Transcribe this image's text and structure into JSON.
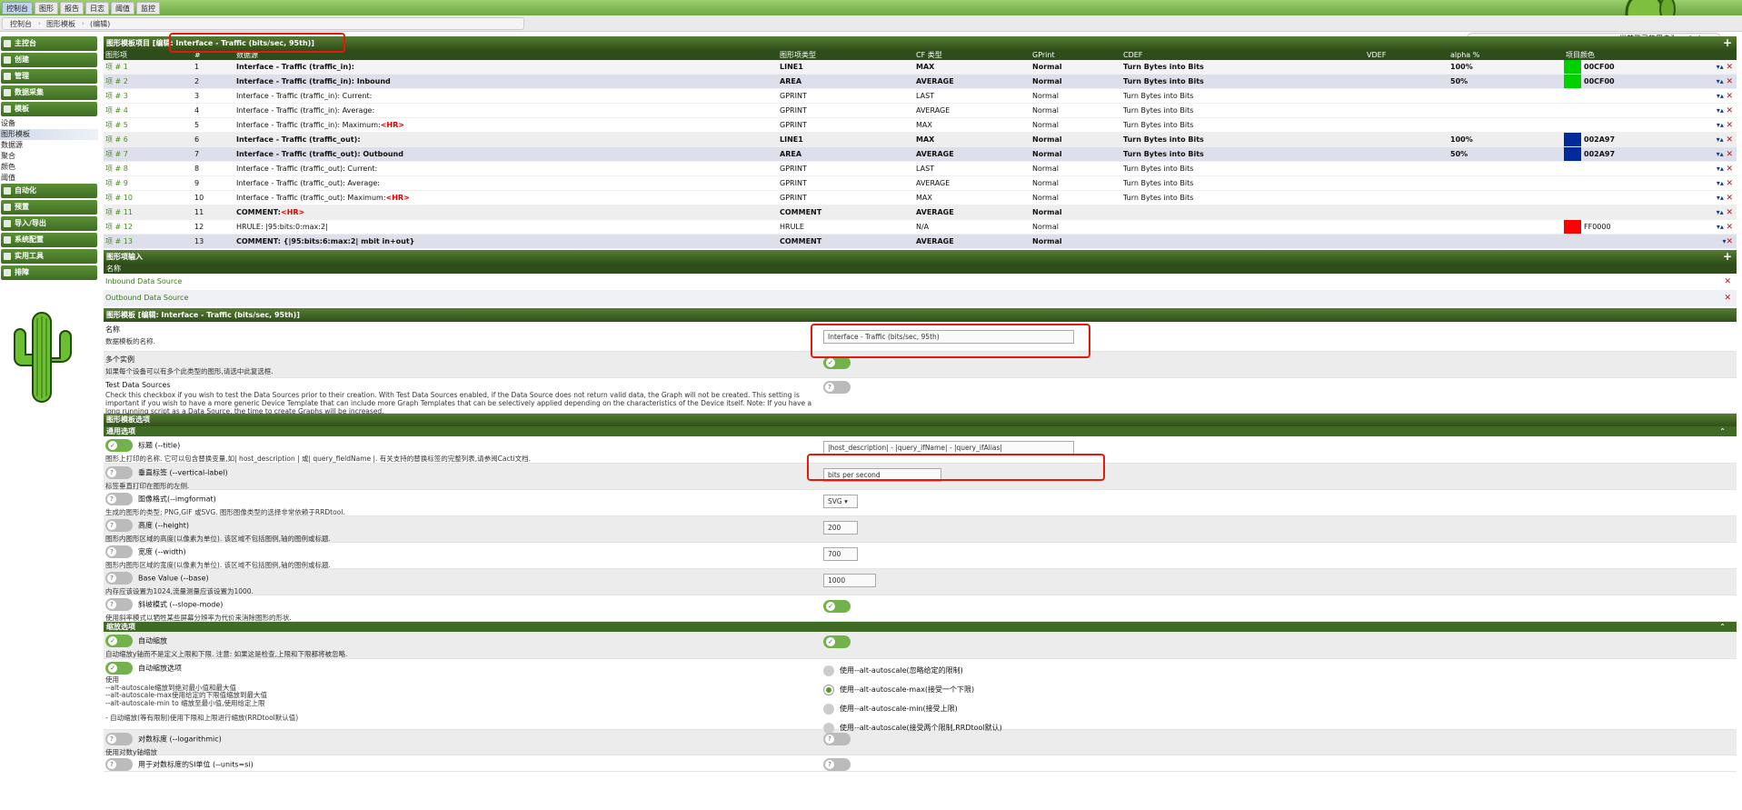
{
  "tabs": [
    "控制台",
    "图形",
    "报告",
    "日志",
    "阈值",
    "监控"
  ],
  "breadcrumbs": [
    "控制台",
    "图形模板",
    "(编辑)"
  ],
  "user_label": "当前登录的用户为: admin ▲",
  "sidebar": {
    "sections": [
      {
        "label": "主控台"
      },
      {
        "label": "创建"
      },
      {
        "label": "管理"
      },
      {
        "label": "数据采集"
      },
      {
        "label": "模板"
      }
    ],
    "template_items": [
      "设备",
      "图形模板",
      "数据源",
      "聚合",
      "颜色",
      "阈值"
    ],
    "sections2": [
      {
        "label": "自动化"
      },
      {
        "label": "预置"
      },
      {
        "label": "导入/导出"
      },
      {
        "label": "系统配置"
      },
      {
        "label": "实用工具"
      },
      {
        "label": "排障"
      }
    ]
  },
  "items_header": {
    "title": "图形模板项目 [编辑: Interface - Traffic (bits/sec, 95th)]",
    "plus": "+"
  },
  "item_columns": [
    "图形项",
    "#",
    "数据源",
    "图形项类型",
    "CF 类型",
    "GPrint",
    "CDEF",
    "VDEF",
    "alpha %",
    "项目颜色"
  ],
  "items": [
    {
      "item": "项 # 1",
      "n": "1",
      "ds": "Interface - Traffic (traffic_in):",
      "hr": "",
      "type": "LINE1",
      "cf": "MAX",
      "gp": "Normal",
      "cdef": "Turn Bytes into Bits",
      "alpha": "100%",
      "color": "00CF00",
      "hex": "#00CF00",
      "bold": true,
      "bg": "alt1",
      "up": true
    },
    {
      "item": "项 # 2",
      "n": "2",
      "ds": "Interface - Traffic (traffic_in): Inbound",
      "hr": "",
      "type": "AREA",
      "cf": "AVERAGE",
      "gp": "Normal",
      "cdef": "Turn Bytes into Bits",
      "alpha": "50%",
      "color": "00CF00",
      "hex": "#00CF00",
      "bold": true,
      "bg": "alt2",
      "up": true
    },
    {
      "item": "项 # 3",
      "n": "3",
      "ds": "Interface - Traffic (traffic_in): Current:",
      "hr": "",
      "type": "GPRINT",
      "cf": "LAST",
      "gp": "Normal",
      "cdef": "Turn Bytes into Bits",
      "alpha": "",
      "color": "",
      "hex": "",
      "bold": false,
      "bg": "",
      "up": true
    },
    {
      "item": "项 # 4",
      "n": "4",
      "ds": "Interface - Traffic (traffic_in): Average:",
      "hr": "",
      "type": "GPRINT",
      "cf": "AVERAGE",
      "gp": "Normal",
      "cdef": "Turn Bytes into Bits",
      "alpha": "",
      "color": "",
      "hex": "",
      "bold": false,
      "bg": "",
      "up": true
    },
    {
      "item": "项 # 5",
      "n": "5",
      "ds": "Interface - Traffic (traffic_in): Maximum:",
      "hr": "<HR>",
      "type": "GPRINT",
      "cf": "MAX",
      "gp": "Normal",
      "cdef": "Turn Bytes into Bits",
      "alpha": "",
      "color": "",
      "hex": "",
      "bold": false,
      "bg": "",
      "up": true
    },
    {
      "item": "项 # 6",
      "n": "6",
      "ds": "Interface - Traffic (traffic_out):",
      "hr": "",
      "type": "LINE1",
      "cf": "MAX",
      "gp": "Normal",
      "cdef": "Turn Bytes into Bits",
      "alpha": "100%",
      "color": "002A97",
      "hex": "#002A97",
      "bold": true,
      "bg": "alt3",
      "up": true
    },
    {
      "item": "项 # 7",
      "n": "7",
      "ds": "Interface - Traffic (traffic_out): Outbound",
      "hr": "",
      "type": "AREA",
      "cf": "AVERAGE",
      "gp": "Normal",
      "cdef": "Turn Bytes into Bits",
      "alpha": "50%",
      "color": "002A97",
      "hex": "#002A97",
      "bold": true,
      "bg": "alt2",
      "up": true
    },
    {
      "item": "项 # 8",
      "n": "8",
      "ds": "Interface - Traffic (traffic_out): Current:",
      "hr": "",
      "type": "GPRINT",
      "cf": "LAST",
      "gp": "Normal",
      "cdef": "Turn Bytes into Bits",
      "alpha": "",
      "color": "",
      "hex": "",
      "bold": false,
      "bg": "",
      "up": true
    },
    {
      "item": "项 # 9",
      "n": "9",
      "ds": "Interface - Traffic (traffic_out): Average:",
      "hr": "",
      "type": "GPRINT",
      "cf": "AVERAGE",
      "gp": "Normal",
      "cdef": "Turn Bytes into Bits",
      "alpha": "",
      "color": "",
      "hex": "",
      "bold": false,
      "bg": "",
      "up": true
    },
    {
      "item": "项 # 10",
      "n": "10",
      "ds": "Interface - Traffic (traffic_out): Maximum:",
      "hr": "<HR>",
      "type": "GPRINT",
      "cf": "MAX",
      "gp": "Normal",
      "cdef": "Turn Bytes into Bits",
      "alpha": "",
      "color": "",
      "hex": "",
      "bold": false,
      "bg": "",
      "up": true
    },
    {
      "item": "项 # 11",
      "n": "11",
      "ds": "COMMENT:",
      "hr": "<HR>",
      "type": "COMMENT",
      "cf": "AVERAGE",
      "gp": "Normal",
      "cdef": "",
      "alpha": "",
      "color": "",
      "hex": "",
      "bold": true,
      "bg": "alt3",
      "up": true
    },
    {
      "item": "项 # 12",
      "n": "12",
      "ds": "HRULE: |95:bits:0:max:2|",
      "hr": "",
      "type": "HRULE",
      "cf": "N/A",
      "gp": "Normal",
      "cdef": "",
      "alpha": "",
      "color": "FF0000",
      "hex": "#FF0000",
      "bold": false,
      "bg": "",
      "up": true
    },
    {
      "item": "项 # 13",
      "n": "13",
      "ds": "COMMENT: {|95:bits:6:max:2| mbit in+out}",
      "hr": "",
      "type": "COMMENT",
      "cf": "AVERAGE",
      "gp": "Normal",
      "cdef": "",
      "alpha": "",
      "color": "",
      "hex": "",
      "bold": true,
      "bg": "alt2",
      "up": false
    }
  ],
  "inputs_header": {
    "title": "图形项输入",
    "name_col": "名称"
  },
  "inputs": [
    "Inbound Data Source",
    "Outbound Data Source"
  ],
  "template_header": "图形模板 [编辑: Interface - Traffic (bits/sec, 95th)]",
  "tpl": {
    "name_label": "名称",
    "name_desc": "数据模板的名称.",
    "name_value": "Interface - Traffic (bits/sec, 95th)",
    "multi_label": "多个实例",
    "multi_desc": "如果每个设备可以有多个此类型的图形,请选中此复选框.",
    "test_label": "Test Data Sources",
    "test_desc": "Check this checkbox if you wish to test the Data Sources prior to their creation. With Test Data Sources enabled, if the Data Source does not return valid data, the Graph will not be created. This setting is important if you wish to have a more generic Device Template that can include more Graph Templates that can be selectively applied depending on the characteristics of the Device itself. Note: If you have a long running script as a Data Source, the time to create Graphs will be increased."
  },
  "options_header": "图形模板选项",
  "general_header": "通用选项",
  "opts": {
    "title_label": "标题 (--title)",
    "title_desc": "图形上打印的名称. 它可以包含替换变量,如| host_description | 或| query_fieldName |. 有关支持的替换标签的完整列表,请参阅Cacti文档.",
    "title_value": "|host_description| - |query_ifName| - |query_ifAlias|",
    "vlabel_label": "垂直标签 (--vertical-label)",
    "vlabel_desc": "标签垂直打印在图形的左侧.",
    "vlabel_value": "bits per second",
    "img_label": "图像格式(--imgformat)",
    "img_desc": "生成的图形的类型; PNG,GIF 或SVG. 图形图像类型的选择非常依赖于RRDtool.",
    "img_value": "SVG ▾",
    "h_label": "高度 (--height)",
    "h_desc": "图形内图形区域的高度(以像素为单位). 该区域不包括图例,轴的图例或标题.",
    "h_value": "200",
    "w_label": "宽度 (--width)",
    "w_desc": "图形内图形区域的宽度(以像素为单位). 该区域不包括图例,轴的图例或标题.",
    "w_value": "700",
    "base_label": "Base Value (--base)",
    "base_desc": "内存应该设置为1024,流量测量应该设置为1000.",
    "base_value": "1000",
    "slope_label": "斜坡模式 (--slope-mode)",
    "slope_desc": "使用斜率模式以牺牲某些屏幕分辨率为代价来消除图形的形状."
  },
  "scale_header": "缩放选项",
  "scale": {
    "auto_label": "自动缩放",
    "auto_desc": "自动缩放y轴而不是定义上限和下限. 注意: 如果这是检查,上限和下限都将被忽略.",
    "autoopt_label": "自动缩放选项",
    "autoopt_desc": [
      "使用",
      "--alt-autoscale缩放到绝对最小值和最大值",
      "--alt-autoscale-max使用给定的下限值缩放到最大值",
      "--alt-autoscale-min to 缩放至最小值,使用给定上限",
      "",
      "- 自动缩放(等有限制)使用下限和上限进行缩放(RRDtool默认值)"
    ],
    "radios": [
      "使用--alt-autoscale(忽略给定的限制)",
      "使用--alt-autoscale-max(接受一个下限)",
      "使用--alt-autoscale-min(接受上限)",
      "使用--alt-autoscale(接受两个限制,RRDtool默认)"
    ],
    "log_label": "对数标度 (--logarithmic)",
    "log_desc": "使用对数y轴缩放",
    "si_label": "用于对数标度的SI单位 (--units=si)"
  }
}
